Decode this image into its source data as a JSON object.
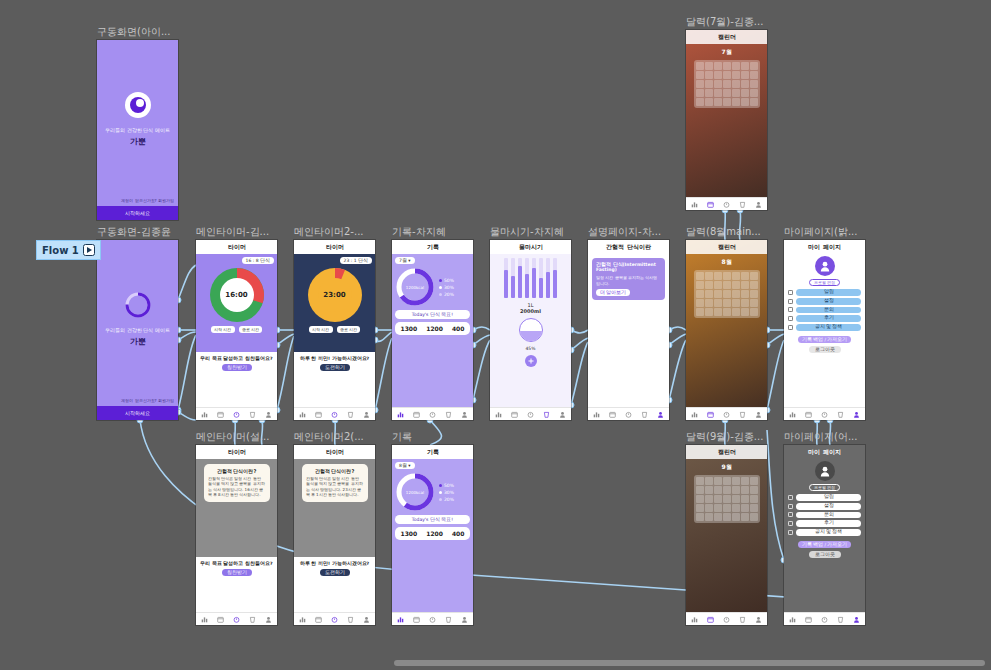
{
  "flow": {
    "label": "Flow 1"
  },
  "scrollbar": {
    "level": 0.6
  },
  "frames": [
    {
      "label": "구동화면(아이...",
      "kind": "splash",
      "loading": false,
      "subtitle": "우리들의 건강한 단식 메이트",
      "title": "가뿐",
      "footer": "계정이 없으신가요? 회원가입",
      "button": "시작하세요"
    },
    {
      "label": "구동화면-김종윤",
      "kind": "splash",
      "loading": true,
      "subtitle": "우리들의 건강한 단식 메이트",
      "title": "가뿐",
      "footer": "계정이 없으신가요? 회원가입",
      "button": "시작하세요"
    },
    {
      "label": "메인타이머-김...",
      "kind": "timer",
      "dark": false,
      "header": "타이머",
      "plan": "16 : 8 단식",
      "time": "16:00",
      "level": 0.3,
      "buttons": [
        "시작 시간",
        "종료 시간"
      ],
      "message": "우리 목표 달성하고 칭찬들어요?",
      "action": "칭찬받기",
      "nav": [
        {
          "selected": false
        },
        {
          "selected": false
        },
        {
          "selected": true
        },
        {
          "selected": false
        },
        {
          "selected": false
        }
      ]
    },
    {
      "label": "메인타이머2-...",
      "kind": "timer",
      "dark": true,
      "header": "타이머",
      "plan": "23 : 1 단식",
      "time": "23:00",
      "level": 0.06,
      "buttons": [
        "시작 시간",
        "종료 시간"
      ],
      "message": "하루 한 끼만! 가능하시겠어요?",
      "action": "도전하기",
      "nav": [
        {
          "selected": false
        },
        {
          "selected": false
        },
        {
          "selected": true
        },
        {
          "selected": false
        },
        {
          "selected": false
        }
      ]
    },
    {
      "label": "기록-차지혜",
      "kind": "record",
      "header": "기록",
      "month": "7월 ▾",
      "level": 0.65,
      "center": "1200kcal",
      "legend": [
        "50%",
        "30%",
        "20%"
      ],
      "banner": "Today's 단식 목표!",
      "stats": [
        "1300",
        "1200",
        "400"
      ],
      "nav": [
        {
          "selected": true
        },
        {
          "selected": false
        },
        {
          "selected": false
        },
        {
          "selected": false
        },
        {
          "selected": false
        }
      ]
    },
    {
      "label": "물마시기-차지혜",
      "kind": "water",
      "header": "물마시기",
      "bars": [
        0.7,
        0.55,
        0.8,
        0.6,
        0.75,
        0.5,
        0.65,
        0.7
      ],
      "amount": "1L",
      "total": "2000ml",
      "percent": "45%",
      "level": 0.45,
      "nav": [
        {
          "selected": false
        },
        {
          "selected": false
        },
        {
          "selected": false
        },
        {
          "selected": true
        },
        {
          "selected": false
        }
      ]
    },
    {
      "label": "설명페이지-차...",
      "kind": "explain",
      "header": "간헐적 단식이란",
      "box_title": "간헐적 단식(Intermittent Fasting)",
      "body": "일정 시간 공복을 유지하는 식사법입니다.",
      "button": "더 알아보기",
      "nav": [
        {
          "selected": false
        },
        {
          "selected": false
        },
        {
          "selected": false
        },
        {
          "selected": false
        },
        {
          "selected": true
        }
      ]
    },
    {
      "label": "달력(8월main...",
      "kind": "calendar",
      "header": "캘린더",
      "month": "8월",
      "color": "#c9822c",
      "nav": [
        {
          "selected": false
        },
        {
          "selected": true
        },
        {
          "selected": false
        },
        {
          "selected": false
        },
        {
          "selected": false
        }
      ]
    },
    {
      "label": "마이페이지(밝...",
      "kind": "mypage",
      "dark": false,
      "header": "마이 페이지",
      "profile": "프로필 편집",
      "items": [
        "알림",
        "설정",
        "문의",
        "후기",
        "공지 및 정책"
      ],
      "button": "기록 백업 / 가져오기",
      "logout": "로그아웃",
      "nav": [
        {
          "selected": false
        },
        {
          "selected": false
        },
        {
          "selected": false
        },
        {
          "selected": false
        },
        {
          "selected": true
        }
      ]
    },
    {
      "label": "달력(7월)-김종...",
      "kind": "calendar",
      "header": "캘린더",
      "month": "7월",
      "color": "#b5563e",
      "nav": [
        {
          "selected": false
        },
        {
          "selected": true
        },
        {
          "selected": false
        },
        {
          "selected": false
        },
        {
          "selected": false
        }
      ]
    },
    {
      "label": "메인타이머(설...",
      "kind": "timer",
      "dark": false,
      "header": "타이머",
      "plan": "16 : 8 단식",
      "time": "16:00",
      "level": 0.3,
      "buttons": [
        "시작 시간",
        "종료 시간"
      ],
      "message": "우리 목표 달성하고 칭찬들어요?",
      "action": "칭찬받기",
      "modal": {
        "title": "간헐적 단식이란?",
        "body": "간헐적 단식은 일정 시간 동안 음식을 먹지 않고 공복을 유지하는 식사 방법입니다. 16시간 공복 후 8시간 동안 식사합니다."
      },
      "nav": [
        {
          "selected": false
        },
        {
          "selected": false
        },
        {
          "selected": true
        },
        {
          "selected": false
        },
        {
          "selected": false
        }
      ]
    },
    {
      "label": "메인타이머2(...",
      "kind": "timer",
      "dark": true,
      "header": "타이머",
      "plan": "23 : 1 단식",
      "time": "23:00",
      "level": 0.06,
      "buttons": [
        "시작 시간",
        "종료 시간"
      ],
      "message": "하루 한 끼만! 가능하시겠어요?",
      "action": "도전하기",
      "modal": {
        "title": "간헐적 단식이란?",
        "body": "간헐적 단식은 일정 시간 동안 음식을 먹지 않고 공복을 유지하는 식사 방법입니다. 23시간 공복 후 1시간 동안 식사합니다."
      },
      "nav": [
        {
          "selected": false
        },
        {
          "selected": false
        },
        {
          "selected": true
        },
        {
          "selected": false
        },
        {
          "selected": false
        }
      ]
    },
    {
      "label": "기록",
      "kind": "record",
      "header": "기록",
      "month": "8월 ▾",
      "level": 0.6,
      "center": "1200kcal",
      "legend": [
        "50%",
        "30%",
        "20%"
      ],
      "banner": "Today's 단식 목표!",
      "stats": [
        "1300",
        "1200",
        "400"
      ],
      "nav": [
        {
          "selected": true
        },
        {
          "selected": false
        },
        {
          "selected": false
        },
        {
          "selected": false
        },
        {
          "selected": false
        }
      ]
    },
    {
      "label": "달력(9월)-김종...",
      "kind": "calendar",
      "header": "캘린더",
      "month": "9월",
      "color": "#6f5a48",
      "nav": [
        {
          "selected": false
        },
        {
          "selected": true
        },
        {
          "selected": false
        },
        {
          "selected": false
        },
        {
          "selected": false
        }
      ]
    },
    {
      "label": "마이페이지(어...",
      "kind": "mypage",
      "dark": true,
      "header": "마이 페이지",
      "profile": "프로필 편집",
      "items": [
        "알림",
        "설정",
        "문의",
        "후기",
        "공지 및 정책"
      ],
      "button": "기록 백업 / 가져오기",
      "logout": "로그아웃",
      "nav": [
        {
          "selected": false
        },
        {
          "selected": false
        },
        {
          "selected": false
        },
        {
          "selected": false
        },
        {
          "selected": true
        }
      ]
    }
  ]
}
